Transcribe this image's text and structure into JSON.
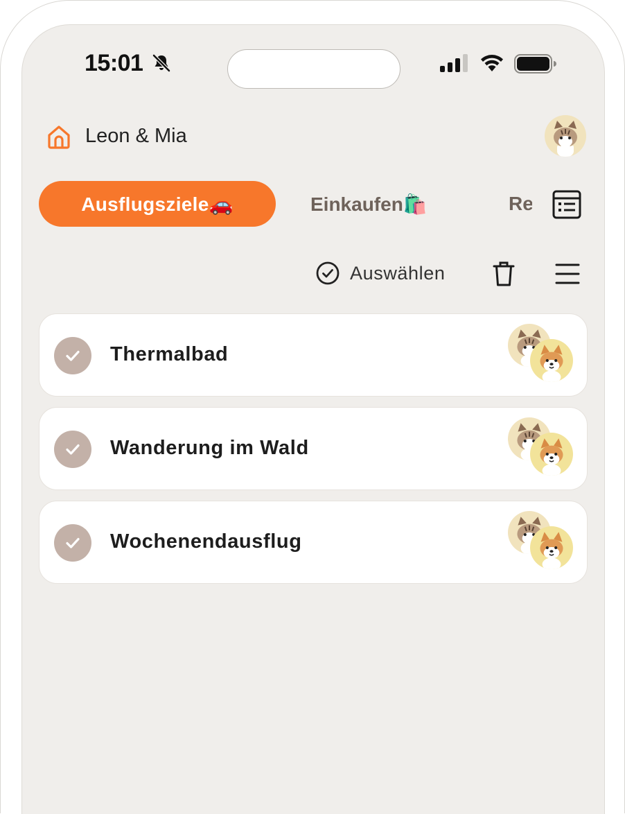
{
  "status_bar": {
    "time": "15:01",
    "icons": [
      "bell-slash-icon",
      "signal-icon",
      "wifi-icon",
      "battery-icon"
    ]
  },
  "header": {
    "title": "Leon & Mia",
    "home_icon": "home-icon",
    "avatar": "cat-avatar"
  },
  "tabs": [
    {
      "label": "Ausflugsziele🚗",
      "active": true
    },
    {
      "label": "Einkaufen🛍️",
      "active": false
    },
    {
      "label": "Re",
      "active": false
    }
  ],
  "toolbar": {
    "select_label": "Auswählen",
    "icons": [
      "check-circle-icon",
      "trash-icon",
      "menu-icon",
      "list-view-icon"
    ]
  },
  "items": [
    {
      "title": "Thermalbad",
      "assignees": [
        "cat-avatar",
        "dog-avatar"
      ]
    },
    {
      "title": "Wanderung im Wald",
      "assignees": [
        "cat-avatar",
        "dog-avatar"
      ]
    },
    {
      "title": "Wochenendausflug",
      "assignees": [
        "cat-avatar",
        "dog-avatar"
      ]
    }
  ],
  "colors": {
    "accent": "#f7772b",
    "background": "#f0eeeb",
    "check_circle": "#c3b1a8",
    "card": "#ffffff"
  }
}
